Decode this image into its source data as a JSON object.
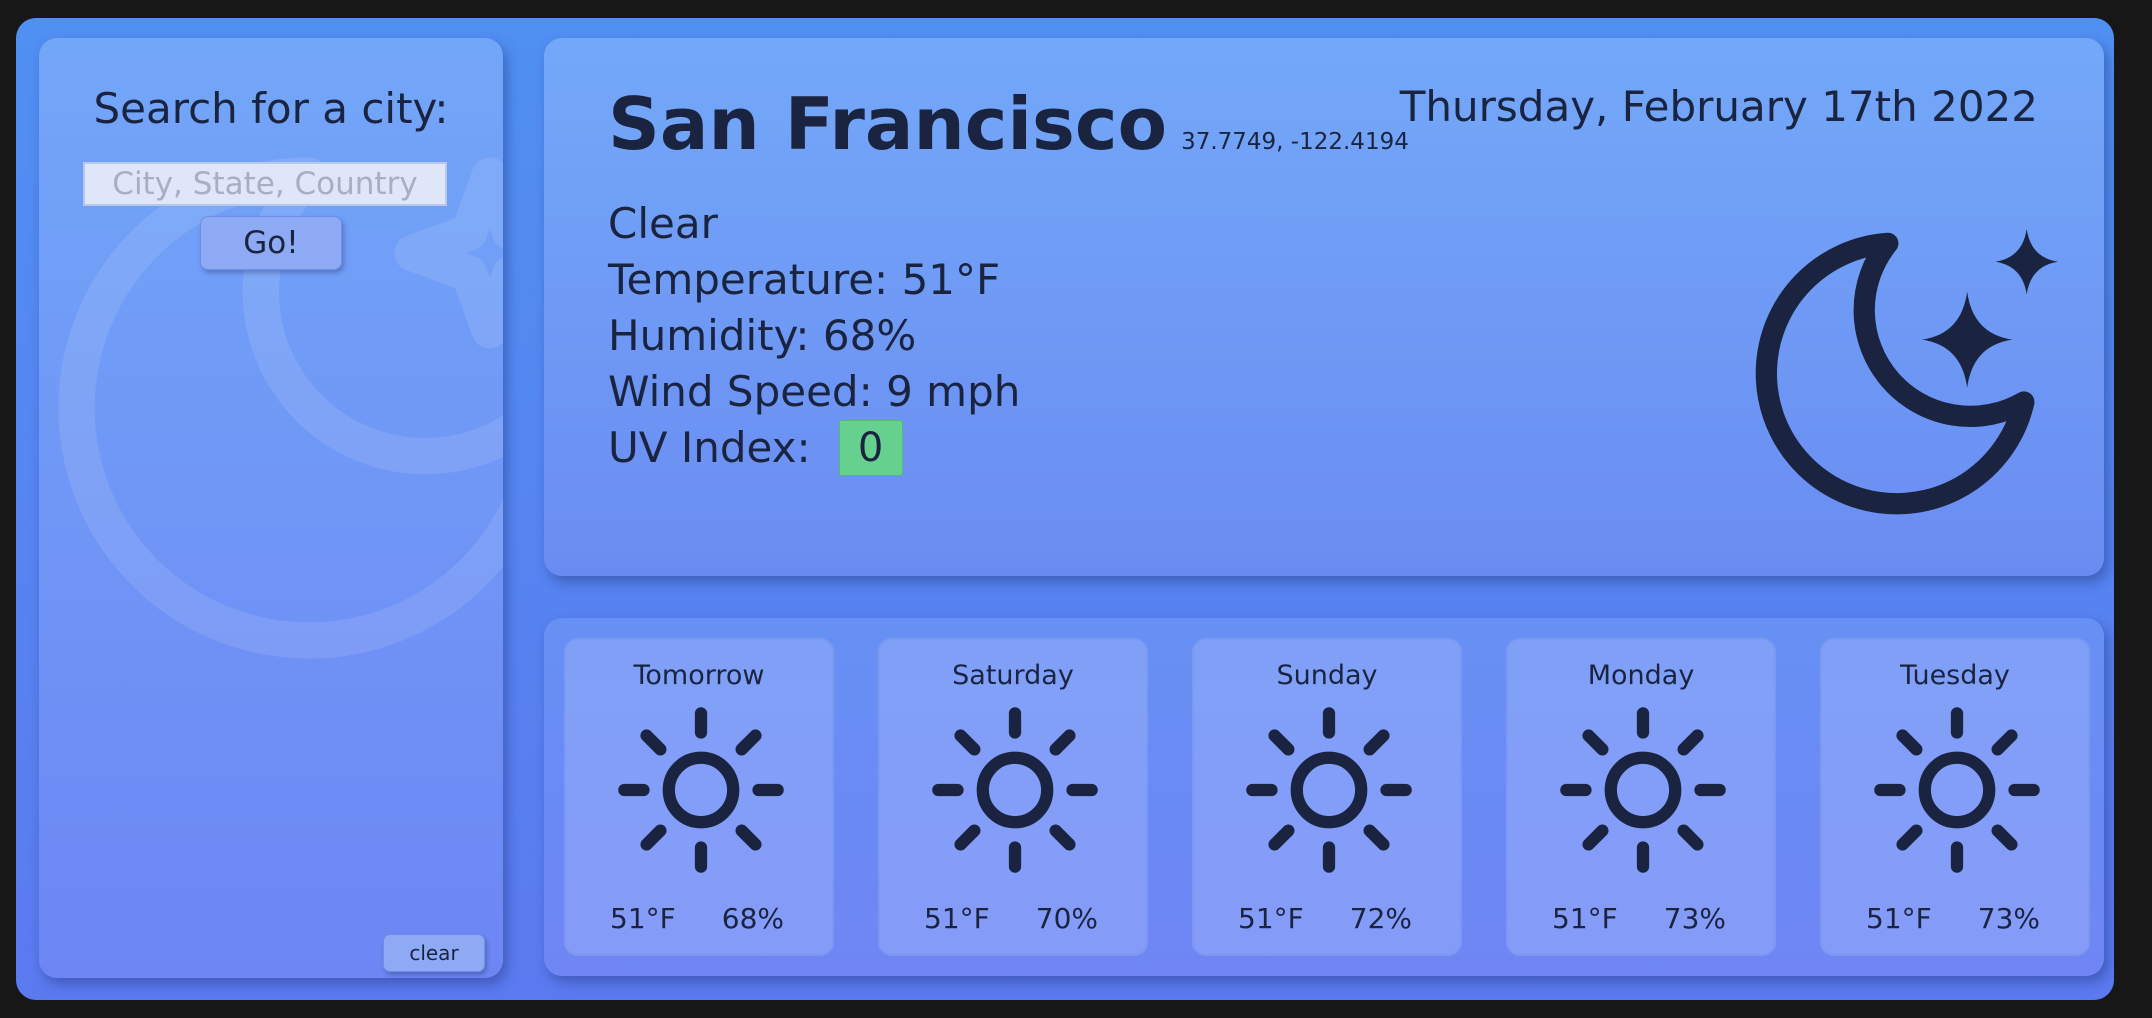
{
  "sidebar": {
    "search_title": "Search for a city:",
    "search_placeholder": "City, State, Country",
    "search_value": "",
    "go_label": "Go!",
    "clear_label": "clear"
  },
  "current": {
    "city": "San Francisco",
    "coords": "37.7749, -122.4194",
    "date": "Thursday, February 17th 2022",
    "condition": "Clear",
    "temperature_label": "Temperature:",
    "temperature": "51°F",
    "humidity_label": "Humidity:",
    "humidity": "68%",
    "wind_label": "Wind Speed:",
    "wind": "9 mph",
    "uv_label": "UV Index:",
    "uv": "0",
    "uv_color": "#66d08e",
    "icon": "moon-stars-icon"
  },
  "forecast": [
    {
      "day": "Tomorrow",
      "temp": "51°F",
      "humidity": "68%",
      "icon": "sun-icon"
    },
    {
      "day": "Saturday",
      "temp": "51°F",
      "humidity": "70%",
      "icon": "sun-icon"
    },
    {
      "day": "Sunday",
      "temp": "51°F",
      "humidity": "72%",
      "icon": "sun-icon"
    },
    {
      "day": "Monday",
      "temp": "51°F",
      "humidity": "73%",
      "icon": "sun-icon"
    },
    {
      "day": "Tuesday",
      "temp": "51°F",
      "humidity": "73%",
      "icon": "sun-icon"
    }
  ],
  "colors": {
    "text": "#1a2440",
    "background_top": "#5090f2",
    "background_bottom": "#5b7af0"
  }
}
